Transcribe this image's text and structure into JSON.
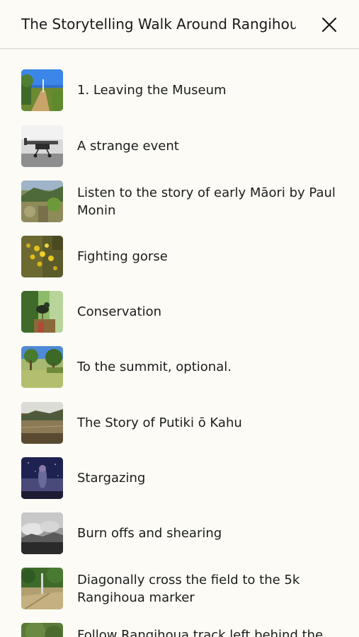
{
  "header": {
    "title": "The Storytelling Walk Around Rangihoua",
    "close_icon": "close-icon"
  },
  "stops": [
    {
      "label": "1. Leaving the Museum",
      "thumb": "museum-path-thumbnail"
    },
    {
      "label": "A strange event",
      "thumb": "airplane-thumbnail"
    },
    {
      "label": "Listen to the story of early Māori by Paul Monin",
      "thumb": "hillside-thumbnail"
    },
    {
      "label": "Fighting gorse",
      "thumb": "gorse-flowers-thumbnail"
    },
    {
      "label": "Conservation",
      "thumb": "bird-in-bush-thumbnail"
    },
    {
      "label": "To the summit, optional.",
      "thumb": "summit-trees-thumbnail"
    },
    {
      "label": "The Story of Putiki ō Kahu",
      "thumb": "valley-field-thumbnail"
    },
    {
      "label": "Stargazing",
      "thumb": "night-sky-thumbnail"
    },
    {
      "label": "Burn offs and shearing",
      "thumb": "smoke-hills-thumbnail"
    },
    {
      "label": "Diagonally cross the field to the 5k Rangihoua marker",
      "thumb": "field-marker-thumbnail"
    },
    {
      "label": "Follow Rangihoua track left behind the",
      "thumb": "track-thumbnail"
    }
  ]
}
